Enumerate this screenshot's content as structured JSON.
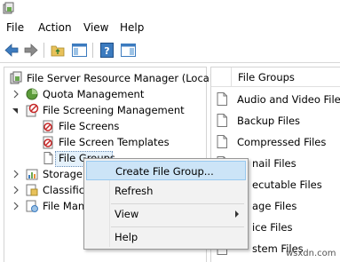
{
  "menubar": {
    "items": [
      "File",
      "Action",
      "View",
      "Help"
    ]
  },
  "tree": {
    "root": "File Server Resource Manager (Local)",
    "quota": "Quota Management",
    "screening": "File Screening Management",
    "screens": "File Screens",
    "templates": "File Screen Templates",
    "groups": "File Groups",
    "storage": "Storage R",
    "classification": "Classifica",
    "filemanagement": "File Man"
  },
  "list": {
    "header": "File Groups",
    "rows": [
      "Audio and Video Files",
      "Backup Files",
      "Compressed Files",
      "nail Files",
      "ecutable Files",
      "age Files",
      "ice Files",
      "stem Files"
    ]
  },
  "context_menu": {
    "items": [
      "Create File Group...",
      "Refresh",
      "View",
      "Help"
    ]
  },
  "watermark": "wsxdn.com",
  "colors": {
    "accent": "#3c7bbf",
    "selection": "#cce4f7",
    "menu_bg": "#f2f2f2"
  }
}
